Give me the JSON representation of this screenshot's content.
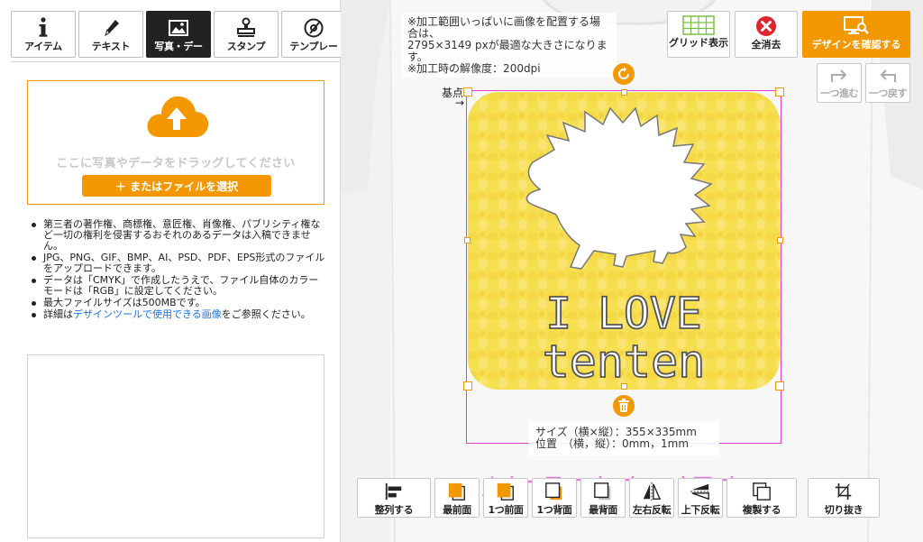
{
  "tabs": [
    {
      "label": "アイテム",
      "icon": "info-icon",
      "active": false
    },
    {
      "label": "テキスト",
      "icon": "pen-icon",
      "active": false
    },
    {
      "label": "写真・デー",
      "icon": "image-icon",
      "active": true
    },
    {
      "label": "スタンプ",
      "icon": "stamp-icon",
      "active": false
    },
    {
      "label": "テンプレー",
      "icon": "template-icon",
      "active": false
    }
  ],
  "upload": {
    "drop_text": "ここに写真やデータをドラッグしてください",
    "file_button": "＋ またはファイルを選択"
  },
  "notes": [
    "第三者の著作権、商標権、意匠権、肖像権、パブリシティ権など一切の権利を侵害するおそれのあるデータは入稿できません。",
    "JPG、PNG、GIF、BMP、AI、PSD、PDF、EPS形式のファイルをアップロードできます。",
    "データは「CMYK」で作成したうえで、ファイル自体のカラーモードは「RGB」に設定してください。",
    "最大ファイルサイズは500MBです。"
  ],
  "note_link": {
    "prefix": "詳細は",
    "link": "デザインツールで使用できる画像",
    "suffix": "をご参照ください。"
  },
  "notice": {
    "line1": "※加工範囲いっぱいに画像を配置する場合は、",
    "line2": "2795×3149 pxが最適な大きさになります。",
    "line3": "※加工時の解像度：200dpi"
  },
  "top_buttons": {
    "grid": "グリッド表示",
    "clear": "全消去",
    "confirm": "デザインを確認する"
  },
  "history": {
    "redo": "一つ進む",
    "undo": "一つ戻す"
  },
  "canvas": {
    "base_label": "基点",
    "base_arrow": "→",
    "art_line1": "I LOVE",
    "art_line2": "tenten"
  },
  "size_info": {
    "size": "サイズ（横×縦）：355×335mm",
    "position": "位置　（横，縦）：0mm，1mm"
  },
  "bottom_toolbar": [
    {
      "label": "整列する",
      "icon": "align-icon"
    },
    {
      "label": "最前面",
      "icon": "bring-front-icon"
    },
    {
      "label": "1つ前面",
      "icon": "bring-forward-icon"
    },
    {
      "label": "1つ背面",
      "icon": "send-backward-icon"
    },
    {
      "label": "最背面",
      "icon": "send-back-icon"
    },
    {
      "label": "左右反転",
      "icon": "flip-horizontal-icon"
    },
    {
      "label": "上下反転",
      "icon": "flip-vertical-icon"
    },
    {
      "label": "複製する",
      "icon": "duplicate-icon"
    },
    {
      "label": "切り抜き",
      "icon": "crop-icon"
    }
  ],
  "colors": {
    "accent": "#f39800",
    "selection": "#e040d0",
    "art_yellow": "#f7df52",
    "link": "#1a73e8",
    "clear_red": "#e0242d"
  }
}
